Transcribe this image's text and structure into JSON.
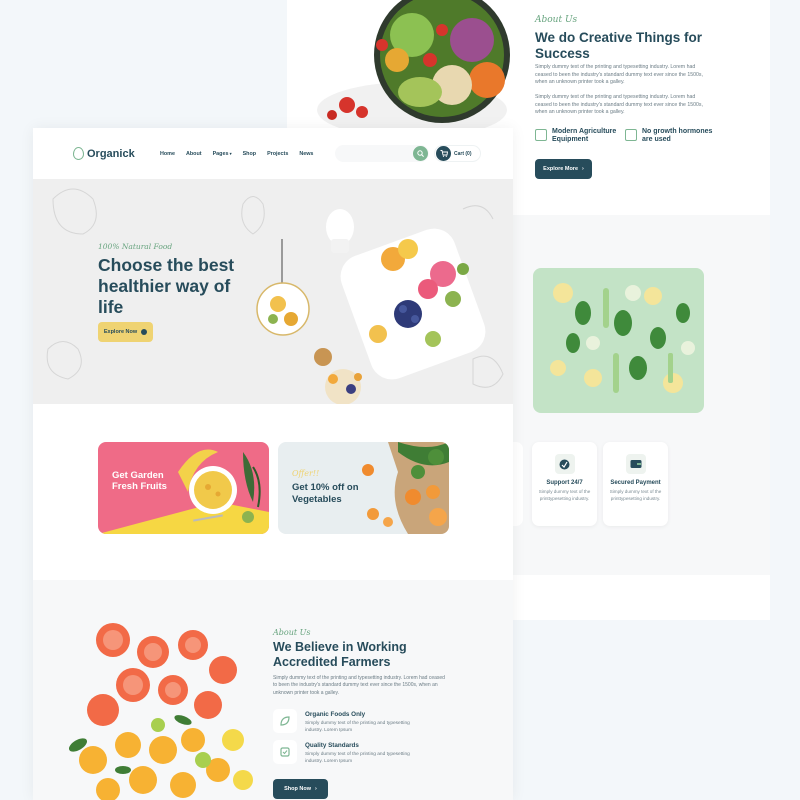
{
  "back": {
    "tag": "About Us",
    "title": "We do Creative Things for Success",
    "para1": "Simply dummy text of the printing and typesetting industry. Lorem had ceased to been the industry's standard dummy text ever since the 1500s, when an unknown printer took a galley.",
    "para2": "Simply dummy text of the printing and typesetting industry. Lorem had ceased to been the industry's standard dummy text ever since the 1500s, when an unknown printer took a galley.",
    "features": [
      "Modern Agriculture Equipment",
      "No growth hormones are used"
    ],
    "button": "Explore More",
    "cards": [
      {
        "title": "Support 24/7",
        "desc": "Simply dummy text of the printtypesetting industry."
      },
      {
        "title": "Secured Payment",
        "desc": "Simply dummy text of the printtypesetting industry."
      }
    ]
  },
  "nav": {
    "logo": "Organick",
    "items": [
      "Home",
      "About",
      "Pages",
      "Shop",
      "Projects",
      "News"
    ],
    "cart": "Cart (0)"
  },
  "hero": {
    "tag": "100% Natural Food",
    "title": "Choose the best healthier way of life",
    "button": "Explore Now"
  },
  "promos": {
    "left_title": "Get Garden Fresh Fruits",
    "right_tag": "Offer!!",
    "right_title": "Get 10% off on Vegetables"
  },
  "about": {
    "tag": "About Us",
    "title": "We Believe in Working Accredited Farmers",
    "para": "Simply dummy text of the printing and typesetting industry. Lorem had ceased to been the industry's standard dummy text ever since the 1500s, when an unknown printer took a galley.",
    "features": [
      {
        "title": "Organic Foods Only",
        "desc": "Simply dummy text of the printing and typesetting industry. Lorem Ipsum"
      },
      {
        "title": "Quality Standards",
        "desc": "Simply dummy text of the printing and typesetting industry. Lorem Ipsum"
      }
    ],
    "button": "Shop Now"
  },
  "colors": {
    "primary": "#274c5b",
    "accent": "#7eb693",
    "yellow": "#efd372",
    "pink": "#ef6b87"
  }
}
